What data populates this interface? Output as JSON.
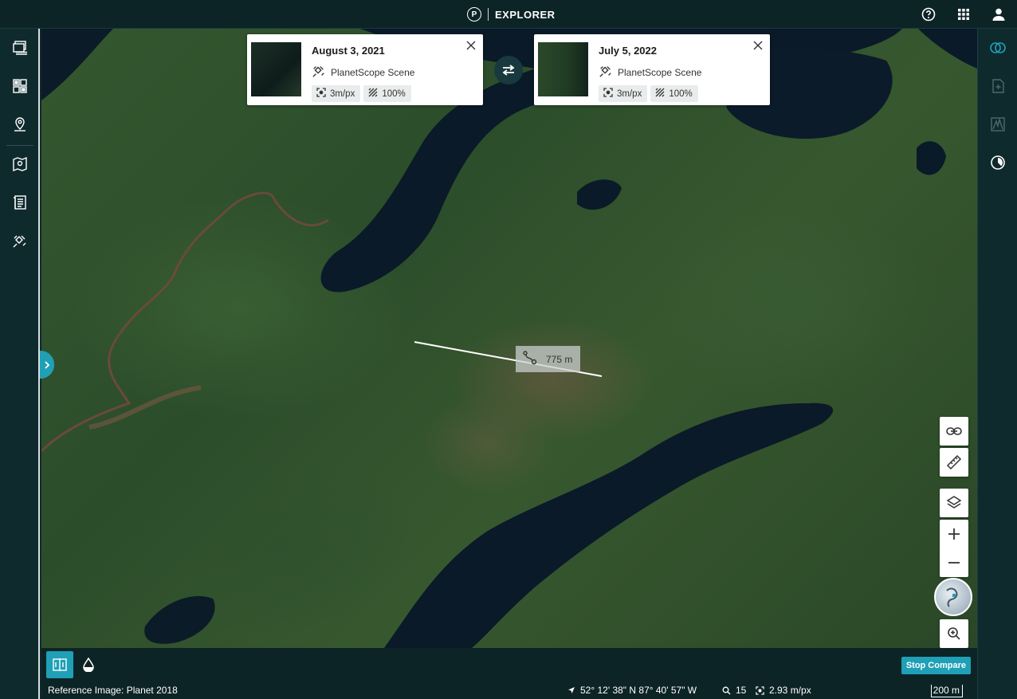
{
  "header": {
    "brand_letter": "P",
    "title": "EXPLORER"
  },
  "top_icons": [
    "help-icon",
    "apps-grid-icon",
    "user-icon"
  ],
  "left_rail": [
    "search-layers-icon",
    "mosaics-icon",
    "places-icon",
    "map-tasks-icon",
    "orders-icon",
    "satellite-icon",
    "settings-icon"
  ],
  "right_rail": [
    "compare-icon",
    "add-image-icon",
    "spectral-icon",
    "timelapse-icon"
  ],
  "compare": {
    "left": {
      "date": "August 3, 2021",
      "type": "PlanetScope Scene",
      "resolution": "3m/px",
      "coverage": "100%"
    },
    "right": {
      "date": "July 5, 2022",
      "type": "PlanetScope Scene",
      "resolution": "3m/px",
      "coverage": "100%"
    }
  },
  "measure": {
    "distance": "775 m"
  },
  "bottom": {
    "stop_compare": "Stop Compare"
  },
  "status": {
    "reference": "Reference Image: Planet 2018",
    "coordinates": "52° 12' 38\" N 87° 40' 57\" W",
    "zoom": "15",
    "resolution": "2.93 m/px",
    "scale": "200 m"
  },
  "colors": {
    "accent": "#1fa0b6",
    "chrome": "#0f2a2d",
    "water": "#0b1c2a"
  }
}
